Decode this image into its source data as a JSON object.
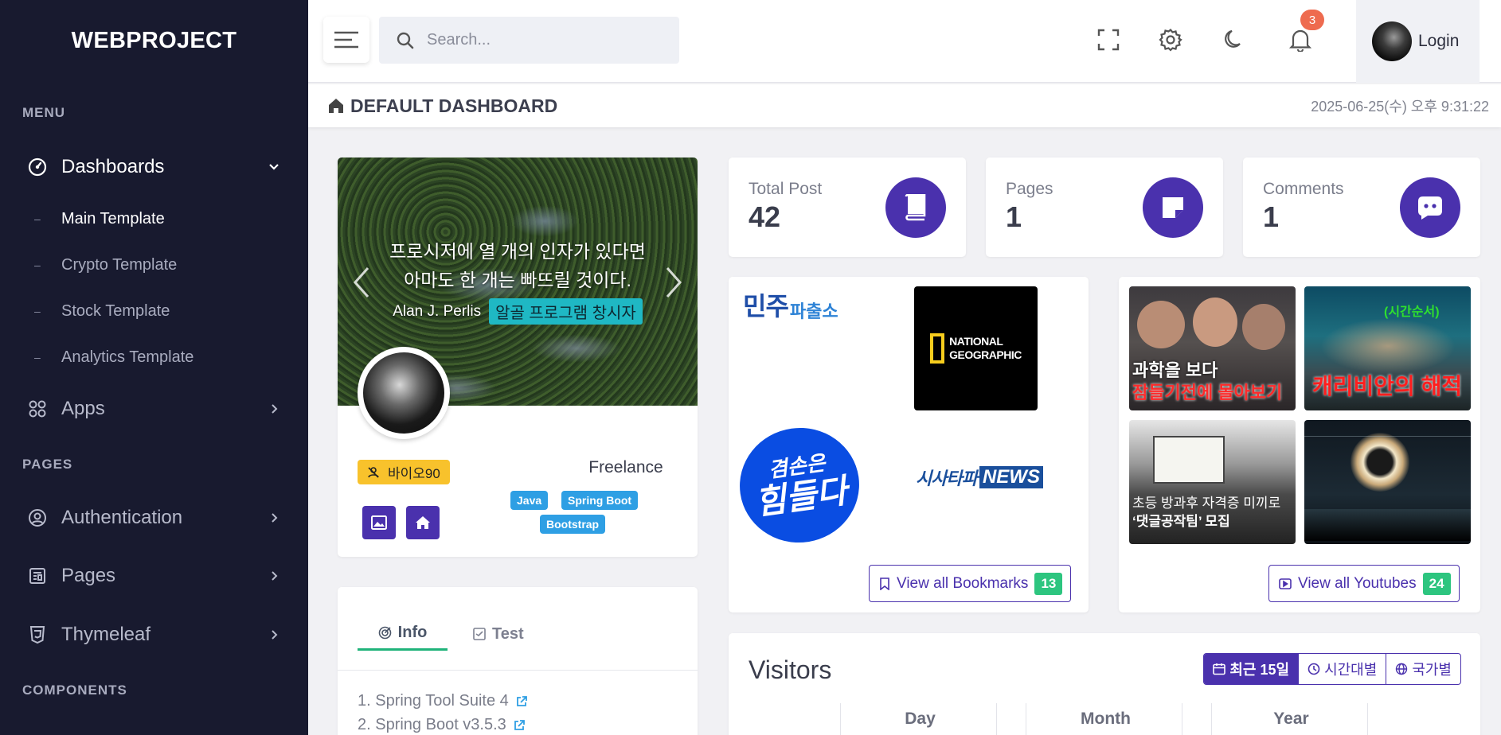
{
  "brand": "WEBPROJECT",
  "sidebar": {
    "menu_title": "MENU",
    "pages_title": "PAGES",
    "components_title": "COMPONENTS",
    "dashboards": "Dashboards",
    "sub_items": [
      "Main Template",
      "Crypto Template",
      "Stock Template",
      "Analytics Template"
    ],
    "apps": "Apps",
    "authentication": "Authentication",
    "pages": "Pages",
    "thymeleaf": "Thymeleaf"
  },
  "topbar": {
    "search_placeholder": "Search...",
    "notification_count": "3",
    "login": "Login"
  },
  "page": {
    "title": "DEFAULT DASHBOARD",
    "datetime": "2025-06-25(수) 오후 9:31:22"
  },
  "profile": {
    "quote_line1": "프로시저에 열 개의 인자가 있다면",
    "quote_line2": "아마도 한 개는 빠뜨릴 것이다.",
    "author": "Alan J. Perlis",
    "author_tag": "알골 프로그램 창시자",
    "user_tag": "바이오90",
    "role": "Freelance",
    "skills": [
      "Java",
      "Spring Boot",
      "Bootstrap"
    ]
  },
  "info": {
    "tabs": [
      "Info",
      "Test"
    ],
    "lines": [
      "1. Spring Tool Suite 4",
      "2. Spring Boot v3.5.3"
    ]
  },
  "stats": [
    {
      "label": "Total Post",
      "value": "42"
    },
    {
      "label": "Pages",
      "value": "1"
    },
    {
      "label": "Comments",
      "value": "1"
    }
  ],
  "bookmarks": {
    "logo1_a": "민주",
    "logo1_b": "파출소",
    "logo2_a": "NATIONAL",
    "logo2_b": "GEOGRAPHIC",
    "logo3_a": "겸손은",
    "logo3_b": "힘들다",
    "logo4_a": "시사타파",
    "logo4_b": "NEWS",
    "view_label": "View all Bookmarks",
    "count": "13"
  },
  "youtubes": {
    "thumb1_line1": "과학을 보다",
    "thumb1_line2": "잠들기전에 몰아보기",
    "thumb2_caption": "캐리비안의 해적",
    "thumb2_tag": "(시간순서)",
    "thumb3_line1": "초등 방과후 자격증 미끼로",
    "thumb3_line2": "‘댓글공작팀’ 모집",
    "view_label": "View all Youtubes",
    "count": "24"
  },
  "visitors": {
    "title": "Visitors",
    "segments": [
      "최근 15일",
      "시간대별",
      "국가별"
    ],
    "columns": [
      "Day",
      "Month",
      "Year"
    ]
  },
  "colors": {
    "sidebar_bg": "#181a2f",
    "accent": "#4a31ad",
    "success": "#2dc57f",
    "warning": "#f8c22c",
    "info": "#2e9fe4"
  }
}
